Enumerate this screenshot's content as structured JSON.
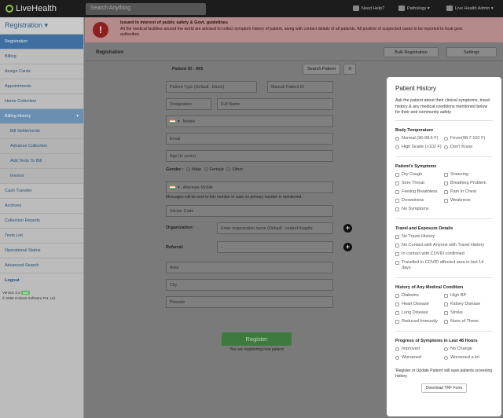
{
  "topbar": {
    "logo": "LiveHealth",
    "search_placeholder": "Search Anything",
    "need_help": "Need Help?",
    "pathology": "Pathology",
    "user": "Live Health Admin"
  },
  "sidebar": {
    "header": "Registration",
    "items": [
      "Registration",
      "Billing",
      "Assign Cards",
      "Appointments",
      "Home Collection",
      "Billing History"
    ],
    "sub_items": [
      "Bill Settlements",
      "Advance Collection",
      "Add Tests To Bill",
      "Invoice"
    ],
    "items2": [
      "Cash Transfer",
      "Archives",
      "Collection Reports",
      "Tests List",
      "Operational Status",
      "Advanced Search"
    ],
    "logout": "Logout",
    "version": "Version 3.3",
    "version_badge": "new",
    "copyright": "© 2009 Creliant Software Pvt. Ltd."
  },
  "alert": {
    "title": "Issued in interest of public safety & Govt. guidelines",
    "text": "All the medical facilities around the world are advised to collect symptom history of patient, along with contact details of all patients. All positive of suspected cases to be reported to local govt. authorities."
  },
  "main": {
    "title": "Registration",
    "bulk_registration": "Bulk Registration",
    "settings": "Settings",
    "patient_id": "Patient ID : 965",
    "search_patient": "Search Patient",
    "patient_type": "Patient Type (Default : Direct)",
    "manual_patient_id": "Manual Patient ID",
    "designation": "Designation",
    "full_name": "Full Name",
    "mobile": "Mobile",
    "email": "Email",
    "age": "Age (in years)",
    "gender_label": "Gender :",
    "gender_options": [
      "Male",
      "Female",
      "Other"
    ],
    "alt_mobile": "Alternate Mobile",
    "alt_mobile_note": "Messages will be sent to this number in case no primary number is mentioned.",
    "sticker_code": "Sticker Code",
    "organization_label": "Organization:",
    "organization_placeholder": "Enter organization name (Default : vedant hospita",
    "referral_label": "Referral:",
    "referral_value": "-",
    "area": "Area",
    "city": "City",
    "pincode": "Pincode",
    "register_button": "Register",
    "register_note": "You are registering new patient"
  },
  "history": {
    "title": "Patient History",
    "description": "Ask the patient about their clinical symptoms, travel history & any medical conditions mentioned below for their and community safety",
    "body_temp": {
      "title": "Body Temperature",
      "options": [
        "Normal (96-98.6 F)",
        "Fever(98.7-102 F)",
        "High Grade (>102 F)",
        "Don't Know"
      ]
    },
    "symptoms": {
      "title": "Patient's Symptoms",
      "options": [
        "Dry Cough",
        "Sneezing",
        "Sore Throat",
        "Breathing Problem",
        "Feeling Breathless",
        "Pain In Chest",
        "Drowsiness",
        "Weakness",
        "No Symptoms"
      ]
    },
    "travel": {
      "title": "Travel and Exposure Details",
      "options": [
        "No Travel History",
        "No Contact with Anyone with Travel History",
        "In contact with COVID confirmed",
        "Travelled in COVID affected area in last 14 days"
      ]
    },
    "medical": {
      "title": "History of Any Medical Condition",
      "options": [
        "Diabetes",
        "High BP",
        "Heart Disease",
        "Kidney Disease",
        "Lung Disease",
        "Stroke",
        "Reduced Immunity",
        "None of These"
      ]
    },
    "progress": {
      "title": "Progress of Symptoms in Last 48 Hours",
      "options": [
        "Improved",
        "No Change",
        "Worsened",
        "Worsened a lot"
      ]
    },
    "footer": "'Register or Update Patient' will save patients screening history.",
    "download": "Download TRF Form"
  }
}
